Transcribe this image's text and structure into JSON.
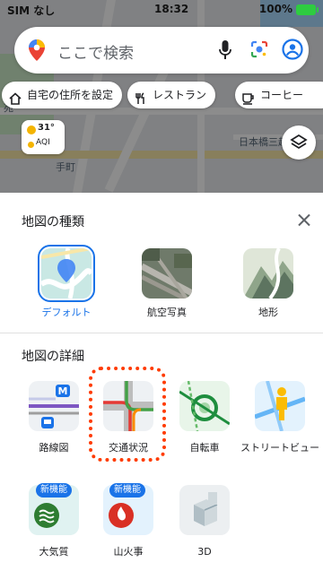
{
  "status": {
    "carrier": "SIM なし",
    "time": "18:32",
    "battery": "100%"
  },
  "map": {
    "labels": [
      "日本橋三越本",
      "手町",
      "苑"
    ]
  },
  "search": {
    "placeholder": "ここで検索"
  },
  "chips": [
    {
      "label": "自宅の住所を設定",
      "icon": "home-icon"
    },
    {
      "label": "レストラン",
      "icon": "restaurant-icon"
    },
    {
      "label": "コーヒー",
      "icon": "coffee-icon"
    }
  ],
  "weather": {
    "temp": "31°",
    "aqi": "AQI"
  },
  "sheet": {
    "map_type_title": "地図の種類",
    "map_details_title": "地図の詳細",
    "map_types": [
      {
        "label": "デフォルト",
        "selected": true
      },
      {
        "label": "航空写真",
        "selected": false
      },
      {
        "label": "地形",
        "selected": false
      }
    ],
    "details": [
      {
        "label": "路線図",
        "badge": ""
      },
      {
        "label": "交通状況",
        "badge": ""
      },
      {
        "label": "自転車",
        "badge": ""
      },
      {
        "label": "ストリートビュー",
        "badge": ""
      },
      {
        "label": "大気質",
        "badge": "新機能"
      },
      {
        "label": "山火事",
        "badge": "新機能"
      },
      {
        "label": "3D",
        "badge": ""
      }
    ]
  },
  "colors": {
    "accent": "#1a73e8",
    "highlight": "#ff3b00"
  }
}
